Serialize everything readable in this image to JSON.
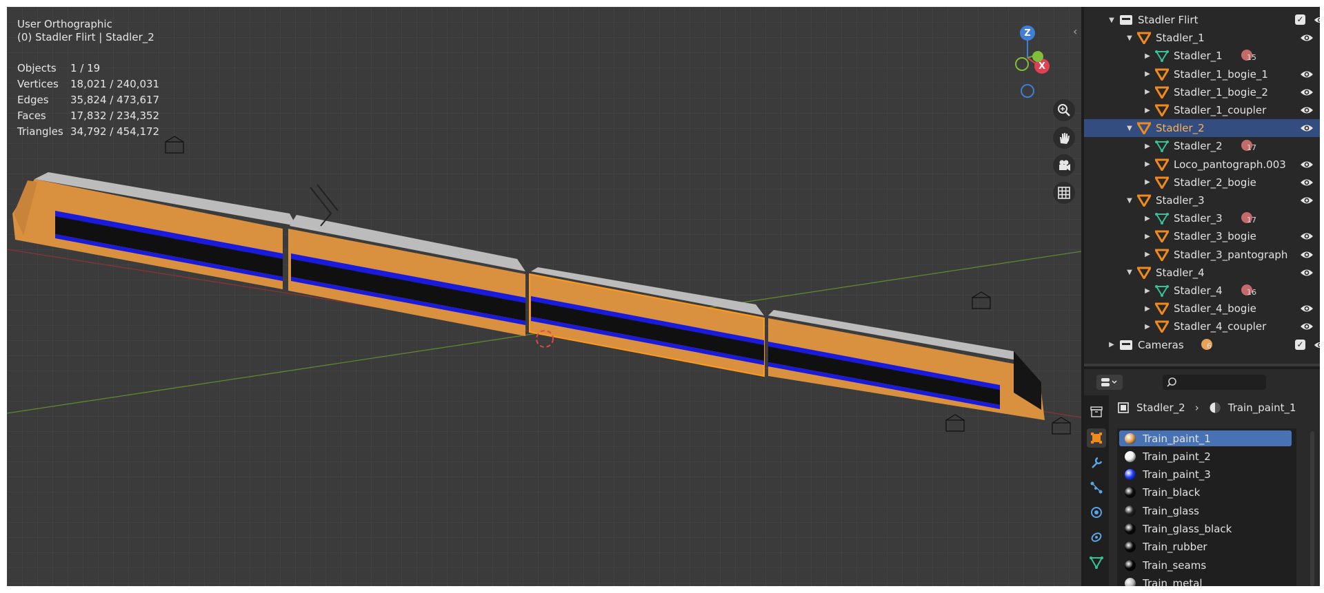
{
  "viewport": {
    "view_name": "User Orthographic",
    "context": "(0) Stadler Flirt | Stadler_2",
    "stats": [
      {
        "label": "Objects",
        "value": "1 / 19"
      },
      {
        "label": "Vertices",
        "value": "18,021 / 240,031"
      },
      {
        "label": "Edges",
        "value": "35,824 / 473,617"
      },
      {
        "label": "Faces",
        "value": "17,832 / 234,352"
      },
      {
        "label": "Triangles",
        "value": "34,792 / 454,172"
      }
    ],
    "gizmo": {
      "z": "Z",
      "x": "X"
    },
    "nav_icons": [
      "zoom-icon",
      "pan-hand-icon",
      "camera-icon",
      "grid-icon"
    ],
    "colors": {
      "body": "#d9913f",
      "stripe": "#1a1adb",
      "roof": "#b5b5b5",
      "window": "#101010",
      "selection": "#ff9a1f"
    }
  },
  "outliner": {
    "rows": [
      {
        "label": "Stadler Flirt",
        "type": "collection",
        "expanded": true,
        "depth": 0,
        "checkbox": true
      },
      {
        "label": "Stadler_1",
        "type": "object",
        "expanded": true,
        "depth": 1
      },
      {
        "label": "Stadler_1",
        "type": "mesh",
        "depth": 2,
        "badge": "15"
      },
      {
        "label": "Stadler_1_bogie_1",
        "type": "object",
        "depth": 2
      },
      {
        "label": "Stadler_1_bogie_2",
        "type": "object",
        "depth": 2
      },
      {
        "label": "Stadler_1_coupler",
        "type": "object",
        "depth": 2
      },
      {
        "label": "Stadler_2",
        "type": "object",
        "expanded": true,
        "depth": 1,
        "selected": true
      },
      {
        "label": "Stadler_2",
        "type": "mesh",
        "depth": 2,
        "badge": "17"
      },
      {
        "label": "Loco_pantograph.003",
        "type": "object",
        "depth": 2
      },
      {
        "label": "Stadler_2_bogie",
        "type": "object",
        "depth": 2
      },
      {
        "label": "Stadler_3",
        "type": "object",
        "expanded": true,
        "depth": 1
      },
      {
        "label": "Stadler_3",
        "type": "mesh",
        "depth": 2,
        "badge": "17"
      },
      {
        "label": "Stadler_3_bogie",
        "type": "object",
        "depth": 2
      },
      {
        "label": "Stadler_3_pantograph",
        "type": "object",
        "depth": 2
      },
      {
        "label": "Stadler_4",
        "type": "object",
        "expanded": true,
        "depth": 1
      },
      {
        "label": "Stadler_4",
        "type": "mesh",
        "depth": 2,
        "badge": "16"
      },
      {
        "label": "Stadler_4_bogie",
        "type": "object",
        "depth": 2
      },
      {
        "label": "Stadler_4_coupler",
        "type": "object",
        "depth": 2
      },
      {
        "label": "Cameras",
        "type": "collection",
        "expanded": false,
        "depth": 0,
        "checkbox": true,
        "badge": "6"
      }
    ]
  },
  "properties": {
    "breadcrumb": {
      "object": "Stadler_2",
      "material": "Train_paint_1"
    },
    "materials": [
      {
        "name": "Train_paint_1",
        "color": "#e8a35a",
        "selected": true
      },
      {
        "name": "Train_paint_2",
        "color": "#f0f0f0"
      },
      {
        "name": "Train_paint_3",
        "color": "#1f3cff"
      },
      {
        "name": "Train_black",
        "color": "#0d0d0d"
      },
      {
        "name": "Train_glass",
        "color": "#222222"
      },
      {
        "name": "Train_glass_black",
        "color": "#0a0a0a"
      },
      {
        "name": "Train_rubber",
        "color": "#080808"
      },
      {
        "name": "Train_seams",
        "color": "#050505"
      },
      {
        "name": "Train_metal",
        "color": "#bdbdbd"
      }
    ]
  }
}
